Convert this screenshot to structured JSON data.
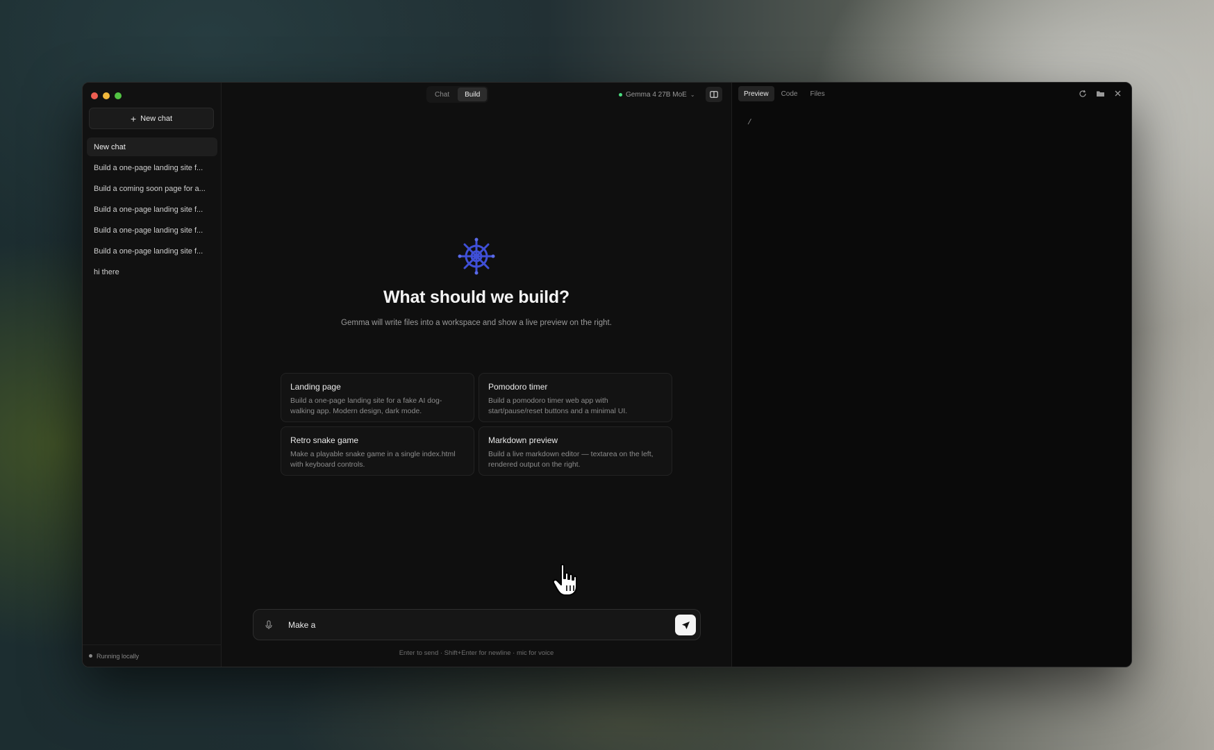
{
  "sidebar": {
    "new_chat_label": "New chat",
    "chats": [
      {
        "label": "New chat"
      },
      {
        "label": "Build a one-page landing site f..."
      },
      {
        "label": "Build a coming soon page for a..."
      },
      {
        "label": "Build a one-page landing site f..."
      },
      {
        "label": "Build a one-page landing site f..."
      },
      {
        "label": "Build a one-page landing site f..."
      },
      {
        "label": "hi there"
      }
    ],
    "status": "Running locally"
  },
  "topbar": {
    "modes": [
      "Chat",
      "Build"
    ],
    "active_mode": "Build",
    "model": "Gemma 4 27B MoE"
  },
  "hero": {
    "title": "What should we build?",
    "subtitle": "Gemma will write files into a workspace and show a live preview on the right."
  },
  "suggestions": [
    {
      "title": "Landing page",
      "desc": "Build a one-page landing site for a fake AI dog-walking app. Modern design, dark mode."
    },
    {
      "title": "Pomodoro timer",
      "desc": "Build a pomodoro timer web app with start/pause/reset buttons and a minimal UI."
    },
    {
      "title": "Retro snake game",
      "desc": "Make a playable snake game in a single index.html with keyboard controls."
    },
    {
      "title": "Markdown preview",
      "desc": "Build a live markdown editor — textarea on the left, rendered output on the right."
    }
  ],
  "composer": {
    "value": "Make a",
    "hint": "Enter to send · Shift+Enter for newline · mic for voice"
  },
  "preview": {
    "tabs": [
      "Preview",
      "Code",
      "Files"
    ],
    "active_tab": "Preview",
    "path": "/"
  },
  "colors": {
    "accent_logo": "#3f4fd6",
    "status_green": "#4ade80"
  }
}
